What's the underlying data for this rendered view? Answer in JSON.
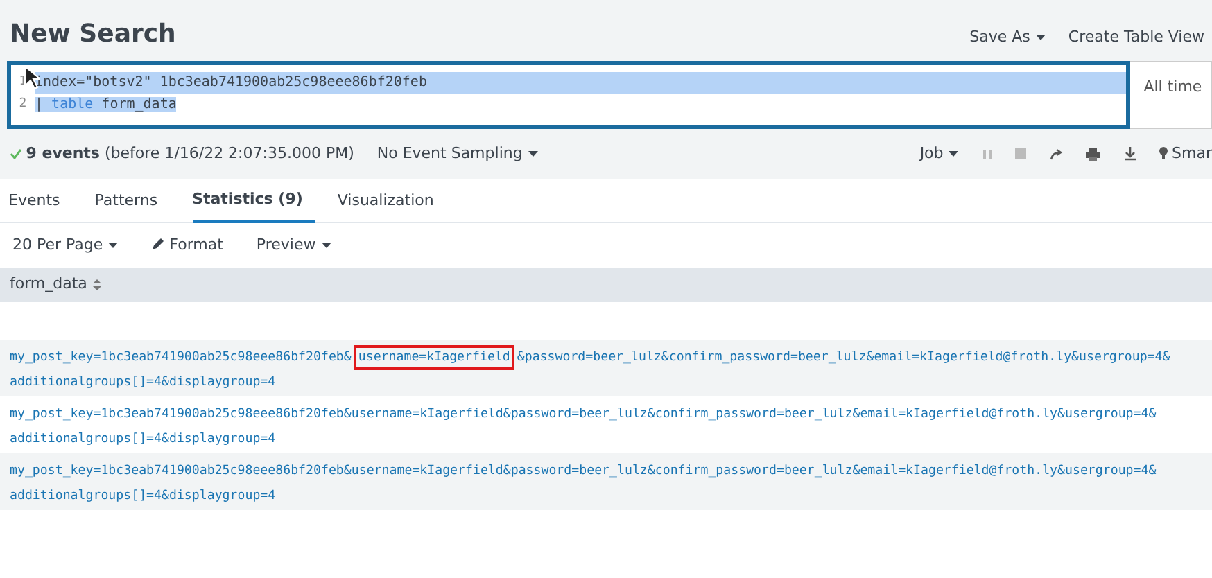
{
  "title": "New Search",
  "header_actions": [
    {
      "label": "Save As",
      "kind": "dropdown"
    },
    {
      "label": "Create Table View",
      "kind": "link"
    }
  ],
  "editor": {
    "selected": true,
    "lines": [
      {
        "number": "1",
        "tokens": [
          {
            "text": "index=\"botsv2\" 1bc3eab741900ab25c98eee86bf20feb",
            "kind": "plain"
          }
        ]
      },
      {
        "number": "2",
        "tokens": [
          {
            "text": "| ",
            "kind": "plain"
          },
          {
            "text": "table",
            "kind": "keyword"
          },
          {
            "text": " form_data",
            "kind": "plain"
          }
        ]
      }
    ]
  },
  "time_range": "All time",
  "status": {
    "count": "9 events",
    "detail": "(before 1/16/22 2:07:35.000 PM)",
    "sampling": "No Event Sampling"
  },
  "job": {
    "label": "Job",
    "more": "Smar"
  },
  "tabs": [
    {
      "label": "Events",
      "selected": false
    },
    {
      "label": "Patterns",
      "selected": false
    },
    {
      "label": "Statistics (9)",
      "selected": true
    },
    {
      "label": "Visualization",
      "selected": false
    }
  ],
  "toolbar": [
    {
      "label": "20 Per Page",
      "kind": "dropdown"
    },
    {
      "label": "Format",
      "kind": "format"
    },
    {
      "label": "Preview",
      "kind": "dropdown"
    }
  ],
  "table": {
    "columns": [
      "form_data"
    ],
    "rows": [
      {
        "segments": [
          {
            "text": "my_post_key=1bc3eab741900ab25c98eee86bf20feb&",
            "boxed": false
          },
          {
            "text": "username=kIagerfield",
            "boxed": true
          },
          {
            "text": "&password=beer_lulz&confirm_password=beer_lulz&email=kIagerfield@froth.ly&usergroup=4&\nadditionalgroups[]=4&displaygroup=4",
            "boxed": false
          }
        ]
      },
      {
        "segments": [
          {
            "text": "my_post_key=1bc3eab741900ab25c98eee86bf20feb&username=kIagerfield&password=beer_lulz&confirm_password=beer_lulz&email=kIagerfield@froth.ly&usergroup=4&\nadditionalgroups[]=4&displaygroup=4",
            "boxed": false
          }
        ]
      },
      {
        "segments": [
          {
            "text": "my_post_key=1bc3eab741900ab25c98eee86bf20feb&username=kIagerfield&password=beer_lulz&confirm_password=beer_lulz&email=kIagerfield@froth.ly&usergroup=4&\nadditionalgroups[]=4&displaygroup=4",
            "boxed": false
          }
        ]
      }
    ]
  }
}
